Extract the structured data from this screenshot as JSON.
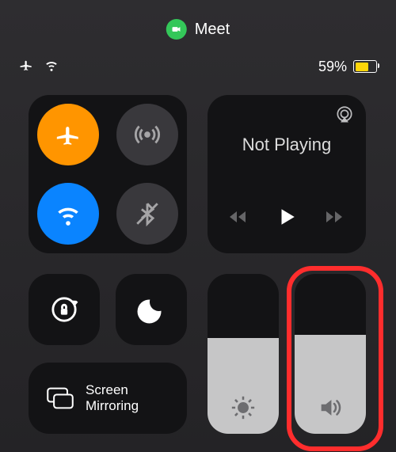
{
  "active_app": {
    "name": "Meet"
  },
  "status": {
    "airplane_mode": true,
    "wifi_connected": true,
    "battery_percent_text": "59%",
    "battery_percent": 59,
    "low_power_mode": true
  },
  "connectivity": {
    "airplane": {
      "on": true,
      "color": "#ff9500"
    },
    "cellular": {
      "on": false
    },
    "wifi": {
      "on": true,
      "color": "#0a84ff"
    },
    "bluetooth": {
      "on": false
    }
  },
  "media": {
    "now_playing_text": "Not Playing",
    "is_playing": false
  },
  "toggles": {
    "orientation_lock": true,
    "do_not_disturb": false
  },
  "mirroring": {
    "label": "Screen\nMirroring"
  },
  "sliders": {
    "brightness_percent": 60,
    "volume_percent": 62
  },
  "highlight": "volume-slider"
}
